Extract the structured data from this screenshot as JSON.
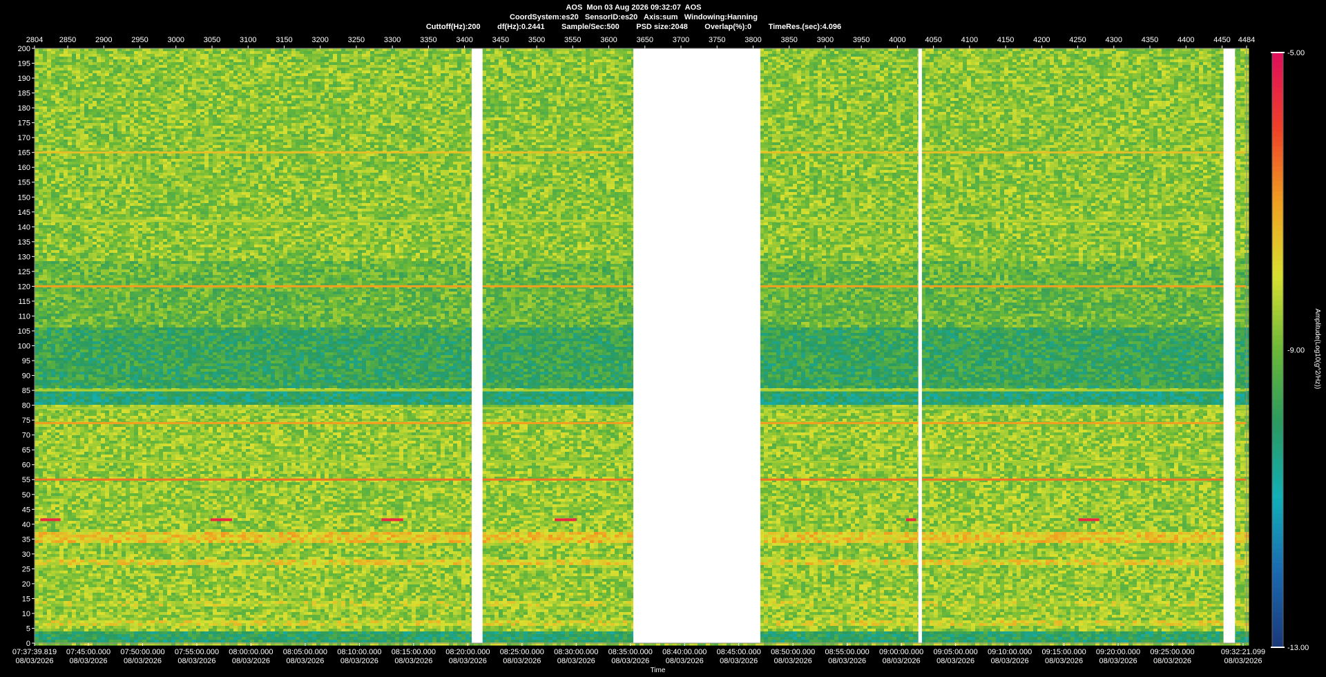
{
  "header": {
    "line1": "AOS  Mon 03 Aug 2026 09:32:07  AOS",
    "line2": "CoordSystem:es20   SensorID:es20   Axis:sum   Windowing:Hanning",
    "line3": "Cuttoff(Hz):200        df(Hz):0.2441        Sample/Sec:500        PSD size:2048        Overlap(%):0        TimeRes.(sec):4.096"
  },
  "colorbar": {
    "label": "Amplitude(Log10(g^2/Hz))",
    "max_label": "-5.00",
    "mid_label": "-9.00",
    "min_label": "-13.00",
    "min": -13,
    "max": -5,
    "stops": [
      "#1a3a7a",
      "#1a6ab0",
      "#12b0b8",
      "#2a9a60",
      "#6ab838",
      "#d8e030",
      "#f0a020",
      "#f04028",
      "#e0105a"
    ]
  },
  "chart_data": {
    "type": "heatmap",
    "title": "AOS  Mon 03 Aug 2026 09:32:07  AOS",
    "xlabel": "Time",
    "ylabel": "",
    "ylim": [
      0,
      200
    ],
    "index_range": [
      2804,
      4484
    ],
    "top_ticks": [
      "2804",
      "2850",
      "2900",
      "2950",
      "3000",
      "3050",
      "3100",
      "3150",
      "3200",
      "3250",
      "3300",
      "3350",
      "3400",
      "3450",
      "3500",
      "3550",
      "3600",
      "3650",
      "3700",
      "3750",
      "3800",
      "3850",
      "3900",
      "3950",
      "4000",
      "4050",
      "4100",
      "4150",
      "4200",
      "4250",
      "4300",
      "4350",
      "4400",
      "4450",
      "4484"
    ],
    "y_ticks": [
      "0",
      "5",
      "10",
      "15",
      "20",
      "25",
      "30",
      "35",
      "40",
      "45",
      "50",
      "55",
      "60",
      "65",
      "70",
      "75",
      "80",
      "85",
      "90",
      "95",
      "100",
      "105",
      "110",
      "115",
      "120",
      "125",
      "130",
      "135",
      "140",
      "145",
      "150",
      "155",
      "160",
      "165",
      "170",
      "175",
      "180",
      "185",
      "190",
      "195",
      "200"
    ],
    "time_ticks": [
      {
        "time": "07:37:39.819",
        "date": "08/03/2026"
      },
      {
        "time": "07:45:00.000",
        "date": "08/03/2026"
      },
      {
        "time": "07:50:00.000",
        "date": "08/03/2026"
      },
      {
        "time": "07:55:00.000",
        "date": "08/03/2026"
      },
      {
        "time": "08:00:00.000",
        "date": "08/03/2026"
      },
      {
        "time": "08:05:00.000",
        "date": "08/03/2026"
      },
      {
        "time": "08:10:00.000",
        "date": "08/03/2026"
      },
      {
        "time": "08:15:00.000",
        "date": "08/03/2026"
      },
      {
        "time": "08:20:00.000",
        "date": "08/03/2026"
      },
      {
        "time": "08:25:00.000",
        "date": "08/03/2026"
      },
      {
        "time": "08:30:00.000",
        "date": "08/03/2026"
      },
      {
        "time": "08:35:00.000",
        "date": "08/03/2026"
      },
      {
        "time": "08:40:00.000",
        "date": "08/03/2026"
      },
      {
        "time": "08:45:00.000",
        "date": "08/03/2026"
      },
      {
        "time": "08:50:00.000",
        "date": "08/03/2026"
      },
      {
        "time": "08:55:00.000",
        "date": "08/03/2026"
      },
      {
        "time": "09:00:00.000",
        "date": "08/03/2026"
      },
      {
        "time": "09:05:00.000",
        "date": "08/03/2026"
      },
      {
        "time": "09:10:00.000",
        "date": "08/03/2026"
      },
      {
        "time": "09:15:00.000",
        "date": "08/03/2026"
      },
      {
        "time": "09:20:00.000",
        "date": "08/03/2026"
      },
      {
        "time": "09:25:00.000",
        "date": "08/03/2026"
      },
      {
        "time": "09:32:21.099",
        "date": "08/03/2026"
      }
    ],
    "data_gaps_index": [
      [
        3410,
        3425
      ],
      [
        3634,
        3810
      ],
      [
        4029,
        4034
      ],
      [
        4452,
        4468
      ]
    ],
    "horizontal_lines_hz": [
      {
        "hz": 165,
        "level": -7.5
      },
      {
        "hz": 142,
        "level": -8.3
      },
      {
        "hz": 120,
        "level": -7.0
      },
      {
        "hz": 85,
        "level": -8.4
      },
      {
        "hz": 79,
        "level": -8.4
      },
      {
        "hz": 74,
        "level": -7.0
      },
      {
        "hz": 61,
        "level": -8.5
      },
      {
        "hz": 55,
        "level": -6.5
      }
    ],
    "bands_hz": [
      {
        "from": 0,
        "to": 4,
        "level": -10.0
      },
      {
        "from": 6,
        "to": 8,
        "level": -8.0
      },
      {
        "from": 12,
        "to": 14,
        "level": -8.2
      },
      {
        "from": 26,
        "to": 28,
        "level": -7.8
      },
      {
        "from": 34,
        "to": 37,
        "level": -7.6
      },
      {
        "from": 80,
        "to": 85,
        "level": -10.2
      },
      {
        "from": 86,
        "to": 106,
        "level": -9.8
      },
      {
        "from": 106,
        "to": 128,
        "level": -9.1
      },
      {
        "from": 128,
        "to": 200,
        "level": -8.7
      }
    ],
    "events": [
      {
        "from": 2812,
        "to": 2840,
        "hz": 41.5,
        "level": -5.5
      },
      {
        "from": 3048,
        "to": 3078,
        "hz": 41.5,
        "level": -5.5
      },
      {
        "from": 3285,
        "to": 3315,
        "hz": 41.5,
        "level": -5.5
      },
      {
        "from": 3525,
        "to": 3555,
        "hz": 41.5,
        "level": -5.5
      },
      {
        "from": 4012,
        "to": 4026,
        "hz": 41.5,
        "level": -5.5
      },
      {
        "from": 4251,
        "to": 4280,
        "hz": 41.5,
        "level": -5.5
      }
    ]
  }
}
